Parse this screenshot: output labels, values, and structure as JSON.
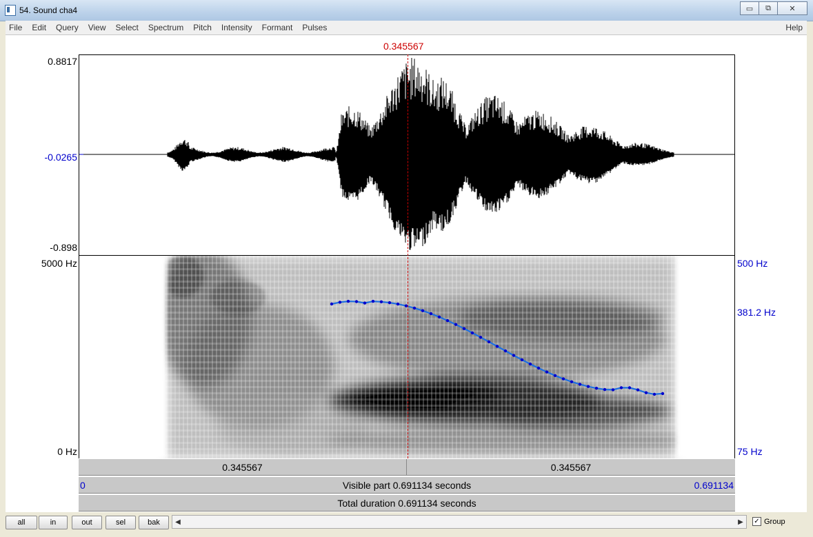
{
  "window": {
    "title": "54. Sound cha4",
    "minimize_glyph": "▭",
    "maximize_glyph": "⧉",
    "close_glyph": "✕"
  },
  "menu": {
    "items": [
      "File",
      "Edit",
      "Query",
      "View",
      "Select",
      "Spectrum",
      "Pitch",
      "Intensity",
      "Formant",
      "Pulses"
    ],
    "help": "Help"
  },
  "cursor": {
    "time_label": "0.345567"
  },
  "waveform": {
    "max_label": "0.8817",
    "mid_label": "-0.0265",
    "min_label": "-0.898"
  },
  "spectrogram": {
    "freq_max_label": "5000 Hz",
    "freq_min_label": "0 Hz",
    "pitch_max_label": "500 Hz",
    "pitch_cursor_label": "381.2 Hz",
    "pitch_min_label": "75 Hz"
  },
  "time_bars": {
    "left_segment": "0.345567",
    "right_segment": "0.345567",
    "visible_start": "0",
    "visible_label": "Visible part 0.691134 seconds",
    "visible_end": "0.691134",
    "total_label": "Total duration 0.691134 seconds"
  },
  "toolbar": {
    "all": "all",
    "in": "in",
    "out": "out",
    "sel": "sel",
    "bak": "bak",
    "scroll_left_glyph": "◀",
    "scroll_right_glyph": "▶",
    "group_label": "Group",
    "group_checked_glyph": "✓"
  },
  "colors": {
    "cursor": "#cc0000",
    "pitch": "#0000cc",
    "pitch_track": "#1e6fe0"
  }
}
